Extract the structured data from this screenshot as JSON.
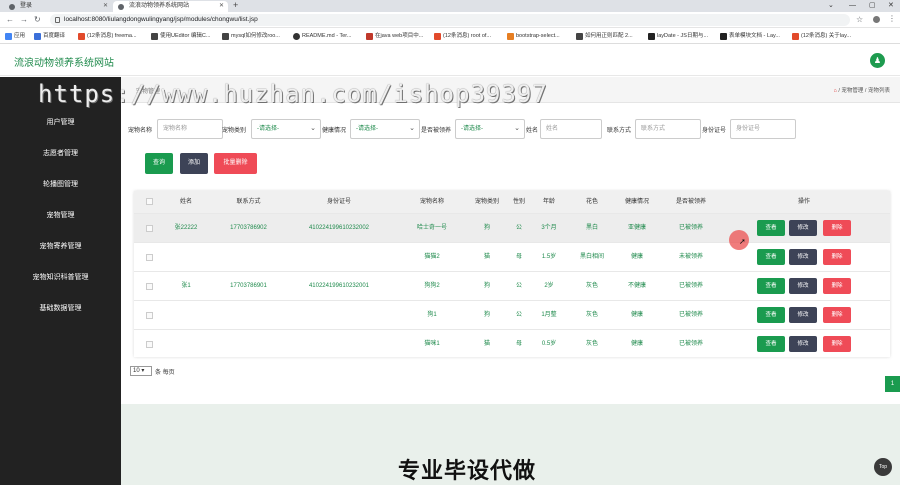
{
  "browser": {
    "tabs": [
      {
        "label": "登录",
        "active": false
      },
      {
        "label": "流浪动物领养系统网站",
        "active": true
      }
    ],
    "new_tab": "+",
    "window_controls": [
      "⌄",
      "—",
      "▢",
      "✕"
    ],
    "url": "localhost:8080/liulangdongwulingyang/jsp/modules/chongwu/list.jsp",
    "bookmarks": [
      {
        "label": "应用",
        "color": "#4285f4"
      },
      {
        "label": "百度翻译",
        "color": "#3b6fd9"
      },
      {
        "label": "(12条消息) freema...",
        "color": "#e24a2b"
      },
      {
        "label": "使用UEditor 编辑C...",
        "color": "#444"
      },
      {
        "label": "mysql如何修改roo...",
        "color": "#444"
      },
      {
        "label": "README.md - Ter...",
        "color": "#333"
      },
      {
        "label": "在java web项目中...",
        "color": "#c0392b"
      },
      {
        "label": "(12条消息) root of...",
        "color": "#e24a2b"
      },
      {
        "label": "bootstrap-select...",
        "color": "#e67e22"
      },
      {
        "label": "如何用正则匹配 2...",
        "color": "#444"
      },
      {
        "label": "layDate - JS日期与...",
        "color": "#222"
      },
      {
        "label": "表单模块文档 - Lay...",
        "color": "#222"
      },
      {
        "label": "(12条消息) 关于lay...",
        "color": "#e24a2b"
      }
    ]
  },
  "header": {
    "brand": "流浪动物领养系统网站",
    "user_icon": "user-icon"
  },
  "sidebar": {
    "items": [
      {
        "label": "用户管理"
      },
      {
        "label": "志愿者管理"
      },
      {
        "label": "轮播图管理"
      },
      {
        "label": "宠物管理"
      },
      {
        "label": "宠物寄养管理"
      },
      {
        "label": "宠物知识科普管理"
      },
      {
        "label": "基础数据管理"
      }
    ]
  },
  "breadcrumb": {
    "title": "宠物管理",
    "home": "⌂",
    "path": "/ 宠物管理 / 宠物列表"
  },
  "filters": {
    "pet_name": {
      "label": "宠物名称",
      "placeholder": "宠物名称"
    },
    "pet_type": {
      "label": "宠物类别",
      "value": "-请选择-"
    },
    "health": {
      "label": "健康情况",
      "value": "-请选择-"
    },
    "adopted": {
      "label": "是否被领养",
      "value": "-请选择-"
    },
    "name": {
      "label": "姓名",
      "placeholder": "姓名"
    },
    "phone": {
      "label": "联系方式",
      "placeholder": "联系方式"
    },
    "id_card": {
      "label": "身份证号",
      "placeholder": "身份证号"
    }
  },
  "actions": {
    "search": "查询",
    "add": "添加",
    "batch_delete": "批量删除"
  },
  "table": {
    "headers": [
      "姓名",
      "联系方式",
      "身份证号",
      "宠物名称",
      "宠物类别",
      "性别",
      "年龄",
      "花色",
      "健康情况",
      "是否被领养",
      "操作"
    ],
    "rows": [
      {
        "name": "张22222",
        "phone": "17703786902",
        "id": "410224199610232002",
        "pet": "哈士奇一号",
        "type": "狗",
        "sex": "公",
        "age": "3个月",
        "color": "黑白",
        "health": "亚健康",
        "adopted": "已被领养"
      },
      {
        "name": "",
        "phone": "",
        "id": "",
        "pet": "猫猫2",
        "type": "猫",
        "sex": "母",
        "age": "1.5岁",
        "color": "黑白相间",
        "health": "健康",
        "adopted": "未被领养"
      },
      {
        "name": "张1",
        "phone": "17703786901",
        "id": "410224199610232001",
        "pet": "狗狗2",
        "type": "狗",
        "sex": "公",
        "age": "2岁",
        "color": "灰色",
        "health": "不健康",
        "adopted": "已被领养"
      },
      {
        "name": "",
        "phone": "",
        "id": "",
        "pet": "狗1",
        "type": "狗",
        "sex": "公",
        "age": "1月整",
        "color": "灰色",
        "health": "健康",
        "adopted": "已被领养"
      },
      {
        "name": "",
        "phone": "",
        "id": "",
        "pet": "猫咪1",
        "type": "猫",
        "sex": "母",
        "age": "0.5岁",
        "color": "灰色",
        "health": "健康",
        "adopted": "已被领养"
      }
    ],
    "row_actions": {
      "view": "查看",
      "edit": "修改",
      "delete": "删除"
    }
  },
  "pagination": {
    "page_size": "10 ▾",
    "page_size_label": "条 每页",
    "current_page": "1"
  },
  "watermark": "https://www.huzhan.com/ishop39397",
  "promo": "专业毕设代做",
  "back_to_top": "Top",
  "colors": {
    "primary": "#1a9b4f",
    "dark": "#3d4357",
    "danger": "#ef4b57",
    "sidebar": "#222222"
  }
}
